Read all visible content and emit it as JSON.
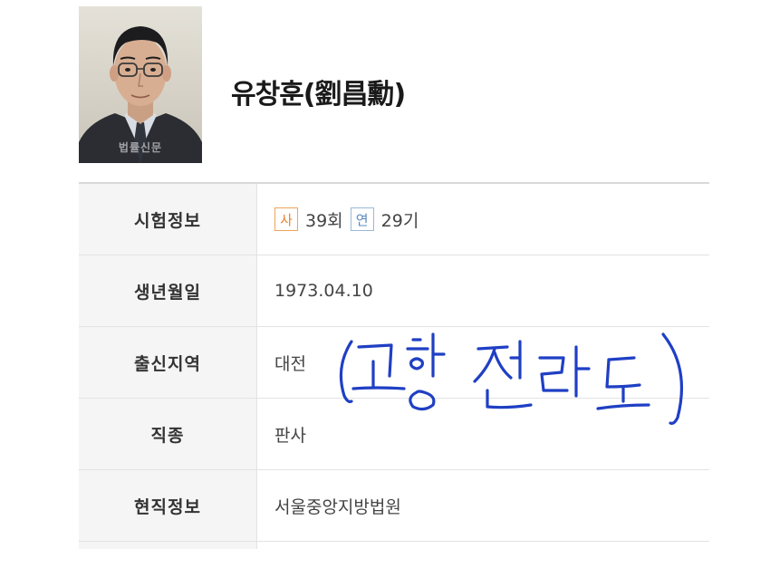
{
  "profile": {
    "name": "유창훈(劉昌勳)",
    "photo_watermark": "법률신문",
    "photo_icon": "portrait-photo"
  },
  "rows": [
    {
      "label": "시험정보",
      "sa_badge": "사",
      "sa_text": "39회",
      "yeon_badge": "연",
      "yeon_text": "29기"
    },
    {
      "label": "생년월일",
      "value": "1973.04.10"
    },
    {
      "label": "출신지역",
      "value": "대전"
    },
    {
      "label": "직종",
      "value": "판사"
    },
    {
      "label": "현직정보",
      "value": "서울중앙지방법원"
    }
  ],
  "annotation": {
    "text": "(고향 전라도)",
    "color": "#1f3fc4"
  },
  "colors": {
    "label_bg": "#f5f5f5",
    "border": "#e3e3e3",
    "sa_badge": "#e8842e",
    "yeon_badge": "#5b8bc0"
  }
}
